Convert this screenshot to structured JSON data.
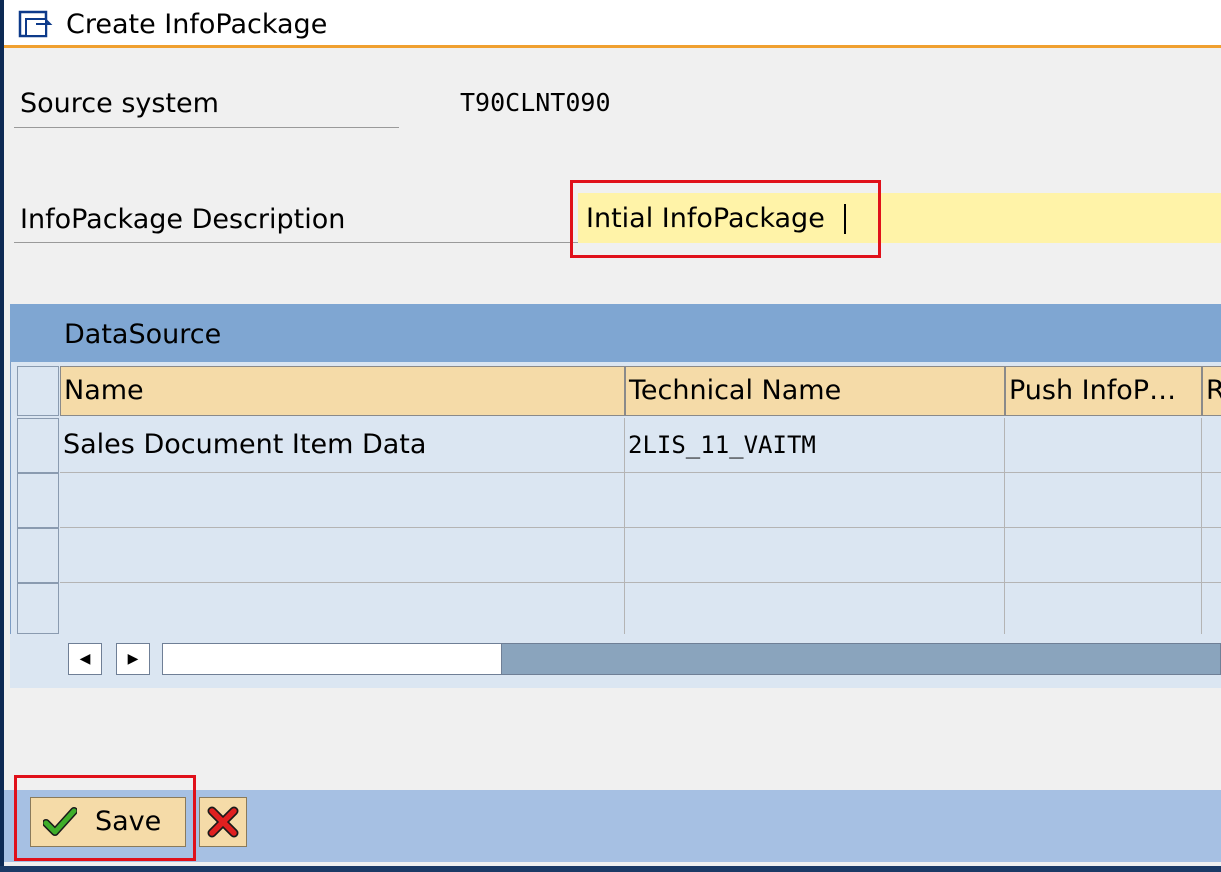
{
  "window": {
    "title": "Create InfoPackage"
  },
  "form": {
    "source_system_label": "Source system",
    "source_system_value": "T90CLNT090",
    "description_label": "InfoPackage Description",
    "description_value": "Intial InfoPackage"
  },
  "table": {
    "title": "DataSource",
    "columns": [
      "Name",
      "Technical Name",
      "Push InfoP…",
      "R"
    ],
    "rows": [
      {
        "name": "Sales Document Item Data",
        "technical_name": "2LIS_11_VAITM",
        "push": "",
        "r": ""
      },
      {
        "name": "",
        "technical_name": "",
        "push": "",
        "r": ""
      },
      {
        "name": "",
        "technical_name": "",
        "push": "",
        "r": ""
      },
      {
        "name": "",
        "technical_name": "",
        "push": "",
        "r": ""
      }
    ]
  },
  "toolbar": {
    "save_label": "Save"
  },
  "colors": {
    "highlight": "#e0101a",
    "header_blue": "#7fa6d2",
    "input_yellow": "#fff3a8"
  },
  "icons": [
    "window-icon",
    "checkmark-icon",
    "cancel-icon",
    "scroll-left-icon",
    "scroll-right-icon"
  ]
}
